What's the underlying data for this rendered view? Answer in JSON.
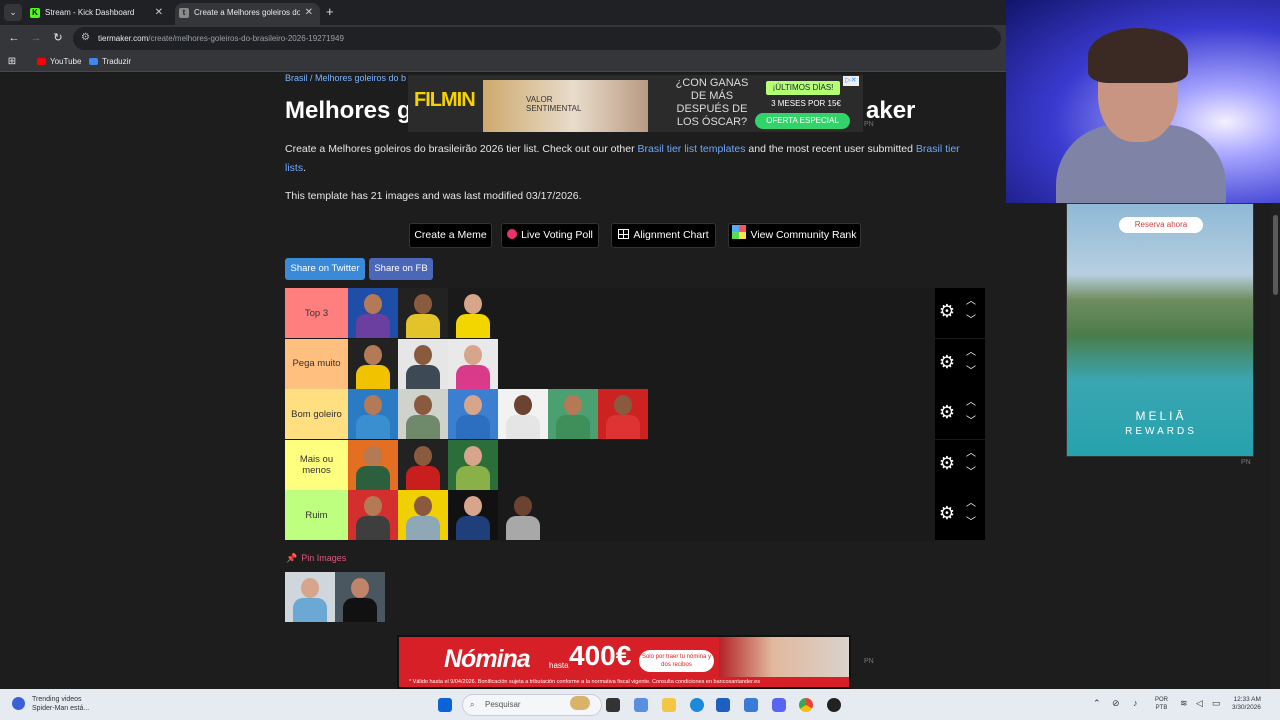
{
  "browser": {
    "tabs": [
      {
        "label": "Stream - Kick Dashboard",
        "favicon": "K",
        "active": false
      },
      {
        "label": "Create a Melhores goleiros do b",
        "favicon": "t",
        "active": true
      }
    ],
    "url_host": "tiermaker.com",
    "url_path": "/create/melhores-goleiros-do-brasileiro-2026-19271949",
    "bookmarks": [
      {
        "label": "YouTube",
        "color": "#ff0000"
      },
      {
        "label": "Traduzir",
        "color": "#4285f4"
      }
    ]
  },
  "page": {
    "breadcrumb": "Brasil / Melhores goleiros do b",
    "title_left": "Melhores g",
    "title_right": "aker",
    "description_pre": "Create a Melhores goleiros do brasileirão 2026 tier list. Check out our other ",
    "description_link1": "Brasil tier list templates",
    "description_mid": " and the most recent user submitted ",
    "description_link2": "Brasil tier lists",
    "description_post": ".",
    "modified_text": "This template has 21 images and was last modified 03/17/2026.",
    "actions": [
      {
        "label": "Create a Meme",
        "icon": ""
      },
      {
        "label": "Live Voting Poll",
        "icon": "record-dot-icon"
      },
      {
        "label": "Alignment Chart",
        "icon": "grid-icon"
      },
      {
        "label": "View Community Rank",
        "icon": "color-grid-icon"
      }
    ],
    "share_twitter": "Share on Twitter",
    "share_fb": "Share on FB",
    "pin_images": "Pin Images"
  },
  "tiers": [
    {
      "label": "Top 3",
      "color": "#ff7f7f",
      "items": 3
    },
    {
      "label": "Pega muito",
      "color": "#ffbf7f",
      "items": 3
    },
    {
      "label": "Bom goleiro",
      "color": "#ffdf7f",
      "items": 6
    },
    {
      "label": "Mais ou menos",
      "color": "#ffff7f",
      "items": 3
    },
    {
      "label": "Ruim",
      "color": "#bfff7f",
      "items": 4
    }
  ],
  "ads": {
    "top": {
      "logo": "FILMIN",
      "img_text": "VALOR SENTIMENTAL",
      "question": "¿CON GANAS DE MÁS DESPUÉS DE LOS ÓSCAR?",
      "badge": "¡ÚLTIMOS DÍAS!",
      "price": "3 MESES POR 15€",
      "cta": "OFERTA ESPECIAL"
    },
    "side": {
      "cta": "Reserva ahora",
      "brand": "MELIĀ",
      "sub": "REWARDS"
    },
    "bottom": {
      "title": "Nómina",
      "hasta": "hasta",
      "amount": "400€",
      "pill": "Solo por traer tu nómina y dos recibos",
      "fine_print": "* Válido hasta el 9/04/2026. Bonificación sujeta a tributación conforme a la normativa fiscal vigente. Consulta condiciones en bancosantander.es"
    },
    "pn": "PN"
  },
  "taskbar": {
    "widget_title": "Trending videos",
    "widget_sub": "Spider-Man está...",
    "search_placeholder": "Pesquisar",
    "lang_top": "POR",
    "lang_bottom": "PTB",
    "time": "12:33 AM",
    "date": "3/30/2026"
  },
  "colors": {
    "accent_link": "#6ea8ff",
    "share_twitter": "#3a8ad8",
    "share_fb": "#4a67b8"
  }
}
